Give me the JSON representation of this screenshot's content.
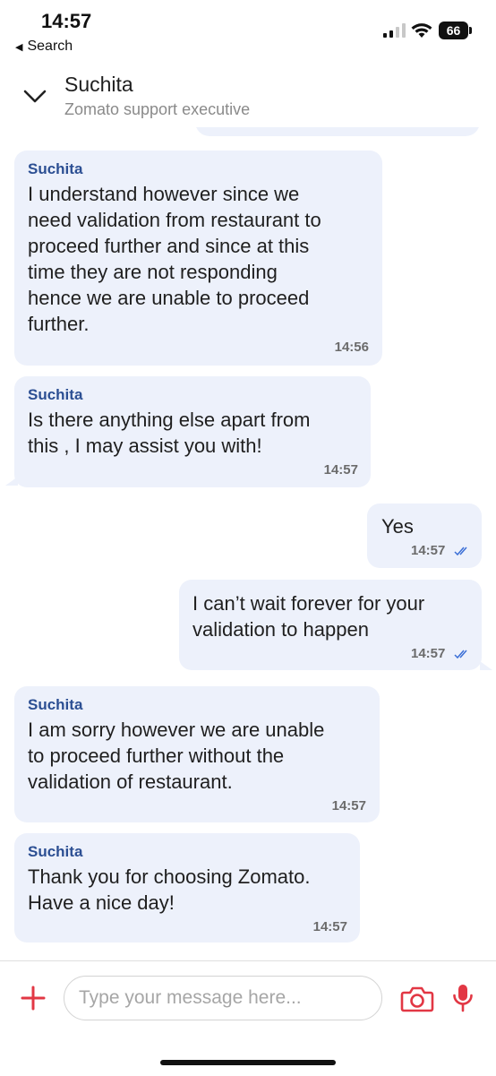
{
  "status_bar": {
    "time": "14:57",
    "back_label": "Search",
    "battery": "66"
  },
  "header": {
    "name": "Suchita",
    "subtitle": "Zomato support executive"
  },
  "messages": [
    {
      "direction": "incoming",
      "sender": "Suchita",
      "lines": [
        "I understand however since we",
        "need validation from restaurant to",
        "proceed further and since at this",
        "time they are not responding",
        "hence we are unable to proceed",
        "further."
      ],
      "time": "14:56"
    },
    {
      "direction": "incoming",
      "sender": "Suchita",
      "lines": [
        "Is there anything else apart from",
        "this , I may assist you with!"
      ],
      "time": "14:57"
    },
    {
      "direction": "outgoing",
      "lines": [
        "Yes"
      ],
      "time": "14:57",
      "status": "read"
    },
    {
      "direction": "outgoing",
      "lines": [
        "I can’t wait forever for your",
        "validation to happen"
      ],
      "time": "14:57",
      "status": "read"
    },
    {
      "direction": "incoming",
      "sender": "Suchita",
      "lines": [
        "I am sorry however we are unable",
        "to proceed further without the",
        "validation of restaurant."
      ],
      "time": "14:57"
    },
    {
      "direction": "incoming",
      "sender": "Suchita",
      "lines": [
        "Thank you for choosing Zomato.",
        "Have a nice day!"
      ],
      "time": "14:57"
    }
  ],
  "composer": {
    "placeholder": "Type your message here..."
  },
  "colors": {
    "bubble": "#edf1fb",
    "sender": "#2c4f93",
    "accent": "#e23744",
    "read_ticks": "#3b6fd6"
  },
  "icons": {
    "collapse": "chevron-down-icon",
    "attach": "plus-icon",
    "camera": "camera-icon",
    "mic": "microphone-icon",
    "read": "double-check-icon"
  }
}
